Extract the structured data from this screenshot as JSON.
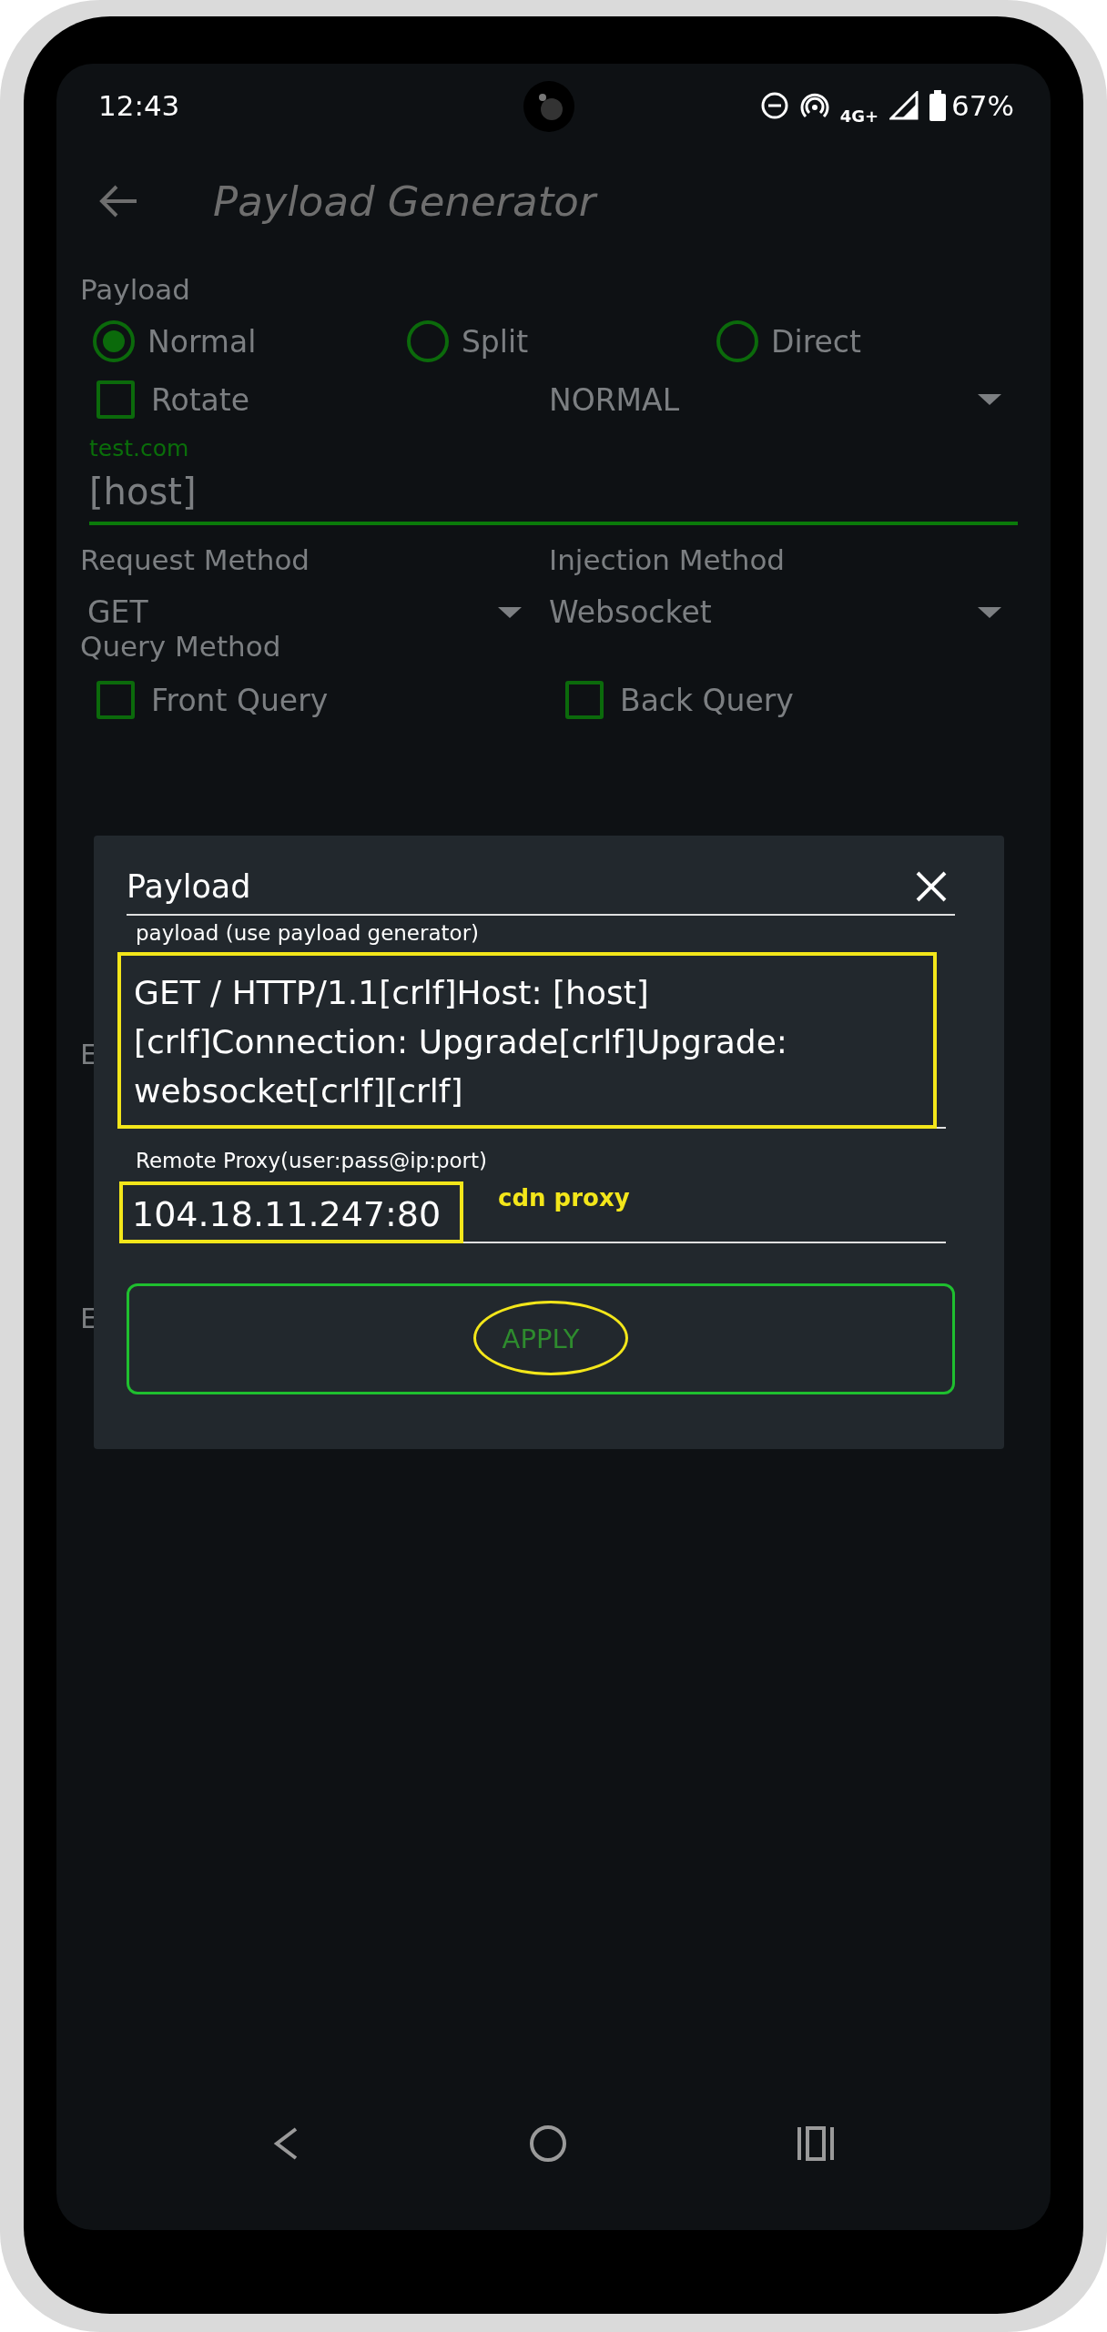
{
  "status_bar": {
    "time": "12:43",
    "network": "4G+",
    "battery": "67%"
  },
  "toolbar": {
    "title": "Payload Generator"
  },
  "payload_section": {
    "label": "Payload",
    "modes": [
      {
        "label": "Normal",
        "selected": true
      },
      {
        "label": "Split",
        "selected": false
      },
      {
        "label": "Direct",
        "selected": false
      }
    ],
    "rotate": {
      "label": "Rotate",
      "checked": false
    },
    "rotate_mode": {
      "value": "NORMAL"
    },
    "host_field": {
      "floating_label": "test.com",
      "value": "[host]"
    }
  },
  "request_method": {
    "label": "Request Method",
    "value": "GET"
  },
  "injection_method": {
    "label": "Injection Method",
    "value": "Websocket"
  },
  "query_method": {
    "label": "Query Method",
    "options": [
      {
        "label": "Front Query",
        "checked": false
      },
      {
        "label": "Back Query",
        "checked": false
      }
    ]
  },
  "covered_labels": [
    "E",
    "E"
  ],
  "dialog": {
    "title": "Payload",
    "payload_field": {
      "label": "payload (use payload generator)",
      "value": "GET / HTTP/1.1[crlf]Host: [host][crlf]Connection: Upgrade[crlf]Upgrade: websocket[crlf][crlf]"
    },
    "proxy_field": {
      "label": "Remote Proxy(user:pass@ip:port)",
      "value": "104.18.11.247:80"
    },
    "annotation_note": "cdn proxy",
    "apply_button": "APPLY"
  }
}
